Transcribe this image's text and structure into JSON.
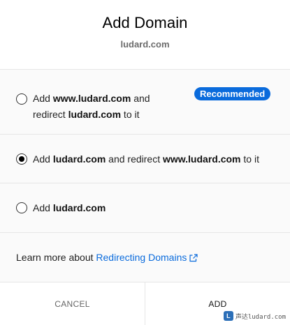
{
  "dialog": {
    "title": "Add Domain",
    "domain": "ludard.com"
  },
  "options": [
    {
      "line1_prefix": "Add ",
      "line1_bold": "www.ludard.com",
      "line1_suffix": " and",
      "line2_prefix": "redirect ",
      "line2_bold": "ludard.com",
      "line2_suffix": " to it",
      "badge": "Recommended",
      "selected": false
    },
    {
      "prefix": "Add ",
      "bold1": "ludard.com",
      "middle": " and redirect ",
      "bold2": "www.ludard.com",
      "suffix": " to it",
      "selected": true
    },
    {
      "prefix": "Add ",
      "bold": "ludard.com",
      "selected": false
    }
  ],
  "learn_more": {
    "text": "Learn more about ",
    "link_text": "Redirecting Domains",
    "icon": "external-link-icon"
  },
  "footer": {
    "cancel_label": "CANCEL",
    "add_label": "ADD"
  },
  "watermark": {
    "logo": "L",
    "text": "声达ludard.com"
  },
  "colors": {
    "accent": "#0a6bdc",
    "panel_bg": "#fafafa",
    "divider": "#e6e6e6"
  }
}
